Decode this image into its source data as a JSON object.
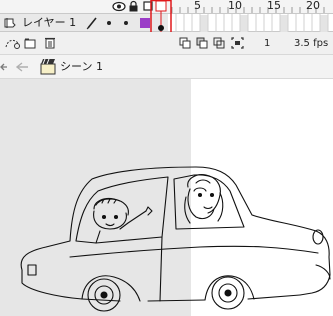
{
  "timeline": {
    "frame_numbers": [
      "5",
      "10",
      "15",
      "20"
    ],
    "layer": {
      "name": "レイヤー 1",
      "color": "#9b3cc7"
    },
    "footer": {
      "current_frame": "1",
      "fps": "3.5 fps"
    },
    "playhead_color": "#e0181b"
  },
  "scene": {
    "name": "シーン 1"
  },
  "stage": {
    "gray": "#e6e6e6",
    "white": "#ffffff"
  }
}
